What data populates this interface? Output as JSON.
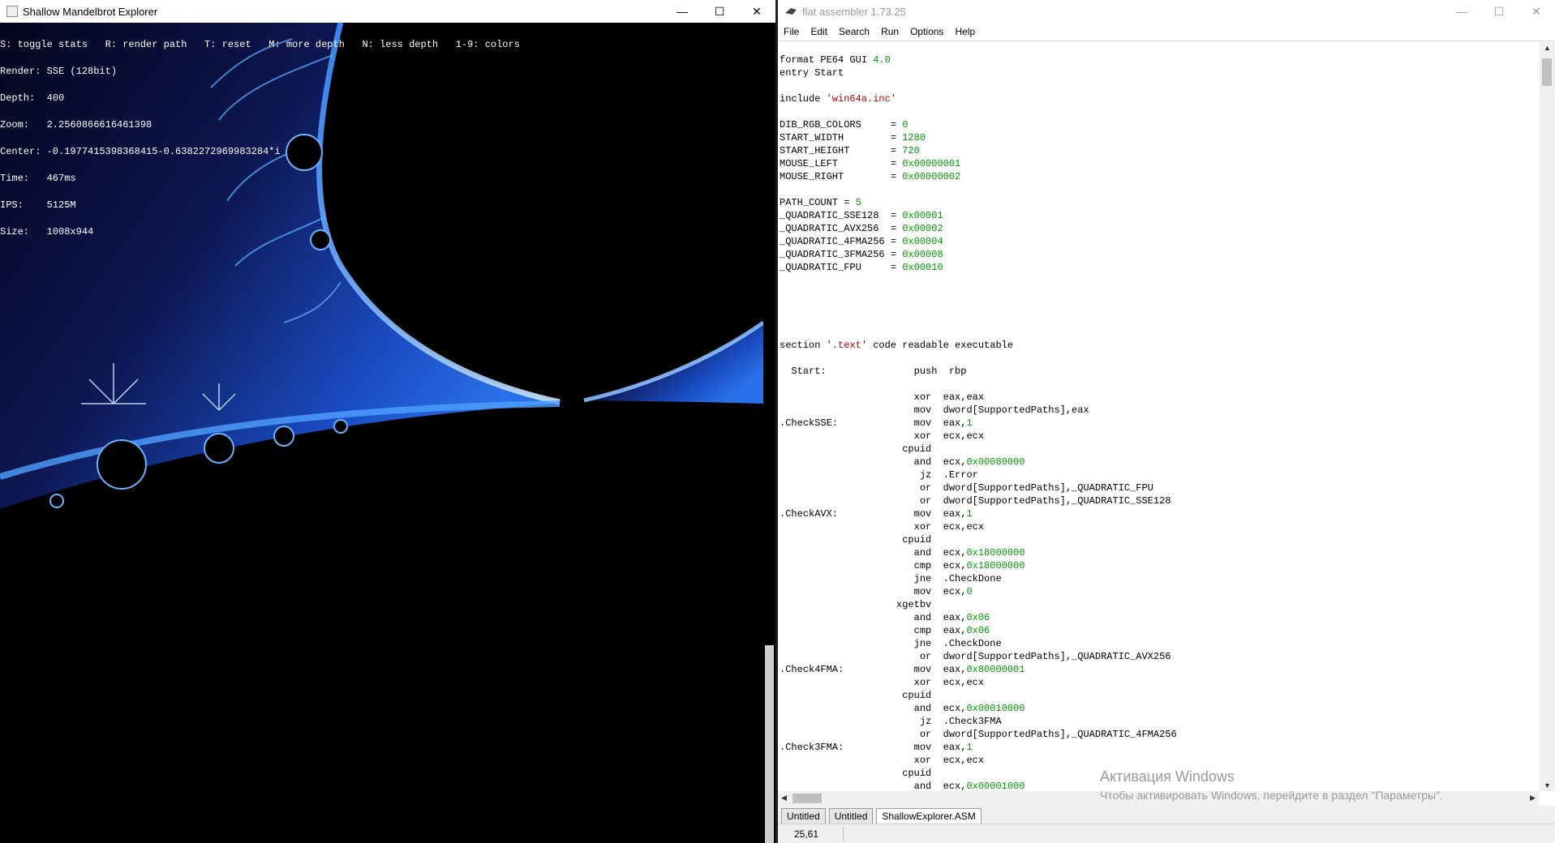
{
  "left_window": {
    "title": "Shallow Mandelbrot Explorer",
    "controls": {
      "minimize": "—",
      "maximize": "☐",
      "close": "✕"
    },
    "hud_lines": [
      "S: toggle stats   R: render path   T: reset   M: more depth   N: less depth   1-9: colors",
      "Render: SSE (128bit)",
      "Depth:  400",
      "Zoom:   2.2560866616461398",
      "Center: -0.1977415398368415-0.6382272969983284*i",
      "Time:   467ms",
      "IPS:    5125M",
      "Size:   1008x944"
    ]
  },
  "right_window": {
    "title": "flat assembler 1.73.25",
    "controls": {
      "minimize": "—",
      "maximize": "☐",
      "close": "✕"
    },
    "menu": [
      "File",
      "Edit",
      "Search",
      "Run",
      "Options",
      "Help"
    ],
    "tabs": [
      "Untitled",
      "Untitled",
      "ShallowExplorer.ASM"
    ],
    "active_tab": 2,
    "cursor_position": "25,61",
    "code_lines": [
      "format PE64 GUI 4.0",
      "entry Start",
      "",
      "include 'win64a.inc'",
      "",
      "DIB_RGB_COLORS     = 0",
      "START_WIDTH        = 1280",
      "START_HEIGHT       = 720",
      "MOUSE_LEFT         = 0x00000001",
      "MOUSE_RIGHT        = 0x00000002",
      "",
      "PATH_COUNT = 5",
      "_QUADRATIC_SSE128  = 0x00001",
      "_QUADRATIC_AVX256  = 0x00002",
      "_QUADRATIC_4FMA256 = 0x00004",
      "_QUADRATIC_3FMA256 = 0x00008",
      "_QUADRATIC_FPU     = 0x00010",
      "",
      "",
      "",
      "",
      "",
      "section '.text' code readable executable",
      "",
      "  Start:               push  rbp",
      "",
      "                       xor  eax,eax",
      "                       mov  dword[SupportedPaths],eax",
      ".CheckSSE:             mov  eax,1",
      "                       xor  ecx,ecx",
      "                     cpuid",
      "                       and  ecx,0x00080000",
      "                        jz  .Error",
      "                        or  dword[SupportedPaths],_QUADRATIC_FPU",
      "                        or  dword[SupportedPaths],_QUADRATIC_SSE128",
      ".CheckAVX:             mov  eax,1",
      "                       xor  ecx,ecx",
      "                     cpuid",
      "                       and  ecx,0x18000000",
      "                       cmp  ecx,0x18000000",
      "                       jne  .CheckDone",
      "                       mov  ecx,0",
      "                    xgetbv",
      "                       and  eax,0x06",
      "                       cmp  eax,0x06",
      "                       jne  .CheckDone",
      "                        or  dword[SupportedPaths],_QUADRATIC_AVX256",
      ".Check4FMA:            mov  eax,0x80000001",
      "                       xor  ecx,ecx",
      "                     cpuid",
      "                       and  ecx,0x00010000",
      "                        jz  .Check3FMA",
      "                        or  dword[SupportedPaths],_QUADRATIC_4FMA256",
      ".Check3FMA:            mov  eax,1",
      "                       xor  ecx,ecx",
      "                     cpuid",
      "                       and  ecx,0x00001000"
    ]
  },
  "watermark": {
    "line1": "Активация Windows",
    "line2": "Чтобы активировать Windows, перейдите в раздел \"Параметры\"."
  },
  "colors": {
    "fractal_deep": "#0a0a2e",
    "fractal_blue": "#1e5fd8",
    "fractal_light": "#a8d4ff",
    "code_number": "#009900",
    "code_string": "#b00000"
  }
}
